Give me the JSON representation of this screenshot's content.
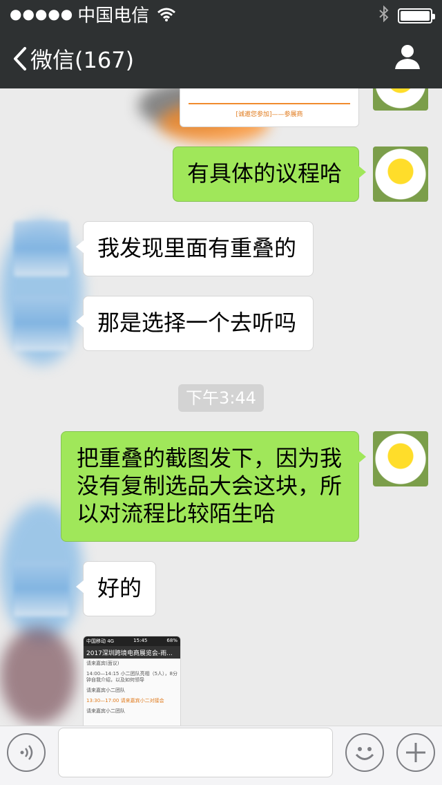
{
  "status_bar": {
    "signal": "●●●●●",
    "carrier": "中国电信",
    "battery_level": 1.0
  },
  "nav": {
    "back_label": "微信(167)"
  },
  "messages": [
    {
      "id": "m1",
      "direction": "outgoing",
      "text": "有具体的议程哈"
    },
    {
      "id": "m2",
      "direction": "incoming",
      "text": "我发现里面有重叠的"
    },
    {
      "id": "m3",
      "direction": "incoming",
      "text": "那是选择一个去听吗"
    },
    {
      "id": "m4",
      "direction": "outgoing",
      "text": "把重叠的截图发下，因为我没有复制选品大会这块，所以对流程比较陌生哈"
    },
    {
      "id": "m5",
      "direction": "incoming",
      "text": "好的"
    }
  ],
  "timestamp": "下午3:44",
  "image_top": {
    "caption": "[诚邀您参加]——参展商"
  },
  "image_bottom": {
    "status_left": "中国移动 4G",
    "status_time": "15:45",
    "status_right": "68%",
    "title": "2017深圳跨境电商展览会-雨...",
    "rows": [
      {
        "text": "请来嘉宾(面议)",
        "orange": false
      },
      {
        "text": "14:00—14:15 小二团队亮相（5人），8分钟自我介绍，以及如何领导",
        "orange": false
      },
      {
        "text": "请来嘉宾小二团队",
        "orange": false
      },
      {
        "text": "13:30—17:00 请来嘉宾小二对接会",
        "orange": true
      },
      {
        "text": "请来嘉宾小二团队",
        "orange": false
      }
    ]
  },
  "input": {
    "placeholder": ""
  }
}
